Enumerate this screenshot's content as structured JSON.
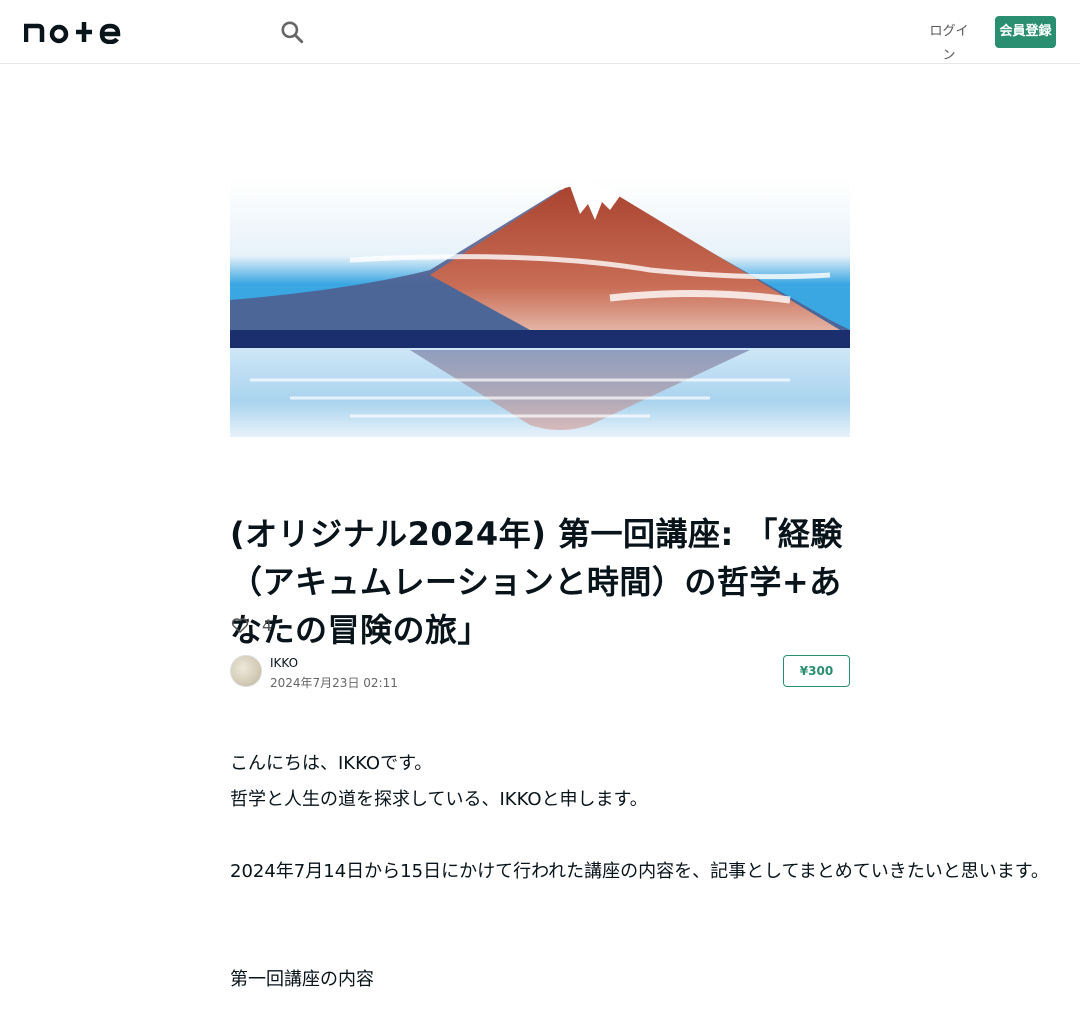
{
  "header": {
    "logo_text": "note",
    "search_icon": "search-icon",
    "login_label": "ログイン",
    "signup_label": "会員登録",
    "accent_color": "#2a8f70"
  },
  "article": {
    "title": "(オリジナル2024年) 第一回講座: 「経験（アキュムレーションと時間）の哲学+あなたの冒険の旅」",
    "like_icon": "heart-outline-icon",
    "like_count": "4",
    "author": {
      "name": "IKKO",
      "date": "2024年7月23日 02:11"
    },
    "price_label": "¥300",
    "paragraphs": [
      "こんにちは、IKKOです。",
      "哲学と人生の道を探求している、IKKOと申します。",
      "2024年7月14日から15日にかけて行われた講座の内容を、記事としてまとめていきたいと思います。",
      "第一回講座の内容"
    ]
  }
}
